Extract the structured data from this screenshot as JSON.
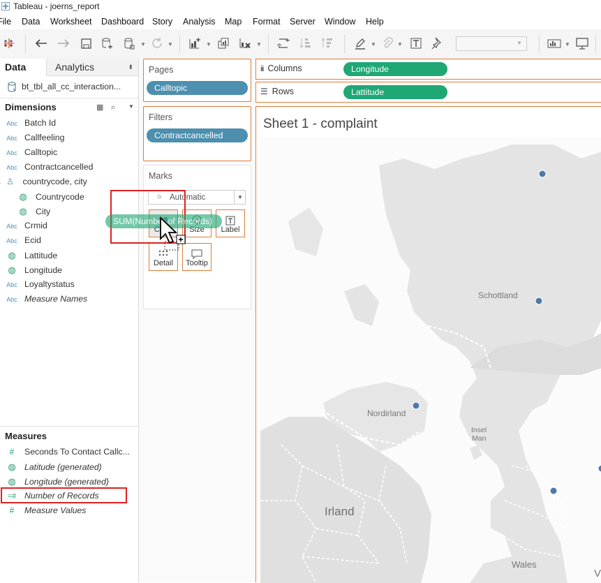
{
  "window": {
    "title": "Tableau - joerns_report"
  },
  "menu": [
    "File",
    "Data",
    "Worksheet",
    "Dashboard",
    "Story",
    "Analysis",
    "Map",
    "Format",
    "Server",
    "Window",
    "Help"
  ],
  "toolbar": {
    "icons": [
      "tableau-logo-icon",
      "back-icon",
      "forward-icon",
      "save-icon",
      "new-datasource-icon",
      "datasource-icon",
      "refresh-icon",
      "new-worksheet-icon",
      "duplicate-sheet-icon",
      "clear-sheet-icon",
      "swap-icon",
      "sort-ascending-icon",
      "sort-descending-icon",
      "highlight-icon",
      "attach-icon",
      "label-icon",
      "pin-icon",
      "fit-dropdown",
      "show-me-icon",
      "presentation-icon"
    ]
  },
  "data_pane": {
    "tabs": {
      "data": "Data",
      "analytics": "Analytics"
    },
    "datasource": "bt_tbl_all_cc_interaction...",
    "dimensions_title": "Dimensions",
    "dimensions": [
      {
        "icon": "Abc",
        "label": "Batch Id",
        "italic": false
      },
      {
        "icon": "Abc",
        "label": "Callfeeling",
        "italic": false
      },
      {
        "icon": "Abc",
        "label": "Calltopic",
        "italic": false
      },
      {
        "icon": "Abc",
        "label": "Contractcancelled",
        "italic": false
      },
      {
        "icon": "hierarchy",
        "label": "countrycode, city",
        "italic": false
      },
      {
        "icon": "globe",
        "label": "Countrycode",
        "italic": false
      },
      {
        "icon": "globe",
        "label": "City",
        "italic": false
      },
      {
        "icon": "Abc",
        "label": "Crmid",
        "italic": false
      },
      {
        "icon": "Abc",
        "label": "Ecid",
        "italic": false
      },
      {
        "icon": "globe",
        "label": "Lattitude",
        "italic": false
      },
      {
        "icon": "globe",
        "label": "Longitude",
        "italic": false
      },
      {
        "icon": "Abc",
        "label": "Loyaltystatus",
        "italic": false
      },
      {
        "icon": "Abc",
        "label": "Measure Names",
        "italic": true
      }
    ],
    "measures_title": "Measures",
    "measures": [
      {
        "icon": "#",
        "label": "Seconds To Contact Callc...",
        "italic": false
      },
      {
        "icon": "globe",
        "label": "Latitude (generated)",
        "italic": true
      },
      {
        "icon": "globe",
        "label": "Longitude (generated)",
        "italic": true
      },
      {
        "icon": "=#",
        "label": "Number of Records",
        "italic": true
      },
      {
        "icon": "#",
        "label": "Measure Values",
        "italic": true
      }
    ]
  },
  "pages": {
    "label": "Pages",
    "pill": "Calltopic"
  },
  "filters": {
    "label": "Filters",
    "pill": "Contractcancelled"
  },
  "marks": {
    "label": "Marks",
    "type": "Automatic",
    "buttons": {
      "color": "Color",
      "size": "Size",
      "label": "Label",
      "detail": "Detail",
      "tooltip": "Tooltip"
    },
    "dragging_pill": "SUM(Number of Records)"
  },
  "columns": {
    "label": "Columns",
    "pill": "Longitude"
  },
  "rows": {
    "label": "Rows",
    "pill": "Lattitude"
  },
  "sheet": {
    "title": "Sheet 1 - complaint"
  },
  "map_labels": {
    "scotland": "Schottland",
    "northern_ireland": "Nordirland",
    "isle_of_man_1": "Insel",
    "isle_of_man_2": "Man",
    "ireland": "Irland",
    "wales": "Wales",
    "edge": "V"
  },
  "colors": {
    "accent_orange": "#e07b39",
    "pill_blue": "#4c8fae",
    "pill_green": "#1fa774",
    "highlight_red": "#e02020",
    "map_point": "#4e79a7"
  }
}
